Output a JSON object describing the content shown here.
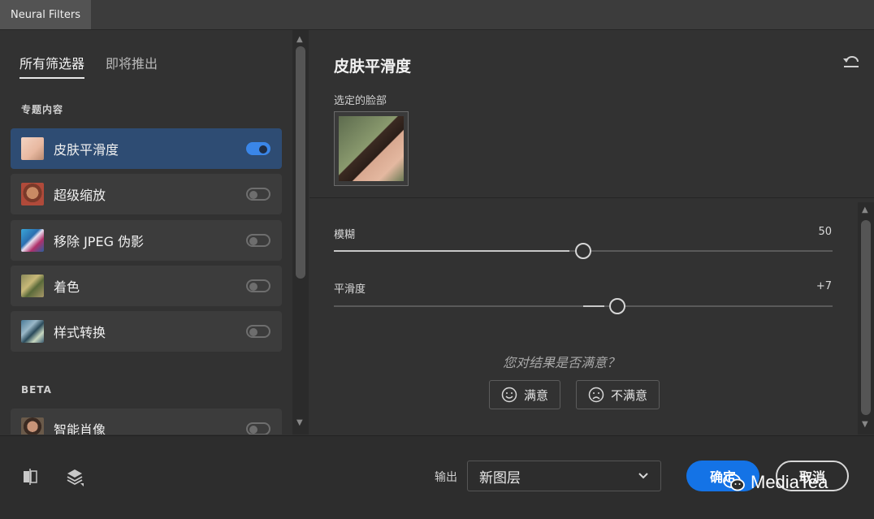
{
  "window": {
    "title": "Neural Filters"
  },
  "left_panel": {
    "tabs": [
      {
        "label": "所有筛选器",
        "active": true
      },
      {
        "label": "即将推出",
        "active": false
      }
    ],
    "featured_label": "专题内容",
    "featured_filters": [
      {
        "label": "皮肤平滑度",
        "enabled": true,
        "selected": true
      },
      {
        "label": "超级缩放",
        "enabled": false
      },
      {
        "label": "移除 JPEG 伪影",
        "enabled": false
      },
      {
        "label": "着色",
        "enabled": false
      },
      {
        "label": "样式转换",
        "enabled": false
      }
    ],
    "beta_label": "BETA",
    "beta_filters": [
      {
        "label": "智能肖像",
        "enabled": false
      }
    ]
  },
  "right_panel": {
    "filter_title": "皮肤平滑度",
    "selected_face_label": "选定的脸部",
    "sliders": [
      {
        "label": "模糊",
        "value": "50",
        "fraction": 0.5
      },
      {
        "label": "平滑度",
        "value": "+7",
        "fraction": 0.57
      }
    ],
    "feedback_question": "您对结果是否满意？",
    "satisfied_label": "满意",
    "unsatisfied_label": "不满意"
  },
  "footer": {
    "output_label": "输出",
    "output_value": "新图层",
    "ok_label": "确定",
    "cancel_label": "取消"
  },
  "watermark": {
    "text": "MediaTea"
  },
  "colors": {
    "accent": "#1473e6",
    "selected_item": "#2e4c73",
    "toggle_on": "#3a86e8"
  }
}
